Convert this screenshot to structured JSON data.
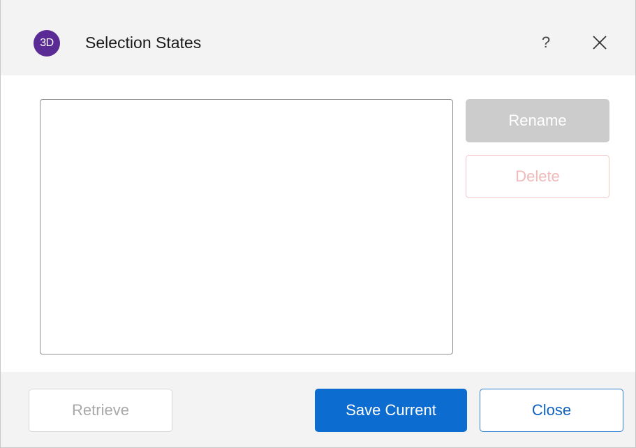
{
  "window": {
    "logo_text": "3D",
    "title": "Selection States",
    "help_label": "?",
    "close_icon": "close-icon"
  },
  "list": {
    "items": []
  },
  "side_buttons": {
    "rename_label": "Rename",
    "delete_label": "Delete"
  },
  "footer": {
    "retrieve_label": "Retrieve",
    "save_label": "Save Current",
    "close_label": "Close"
  },
  "colors": {
    "logo_bg": "#5b2b95",
    "primary": "#0c6cd0",
    "danger_disabled": "#f1b9b9",
    "disabled_fill": "#cccccc"
  }
}
